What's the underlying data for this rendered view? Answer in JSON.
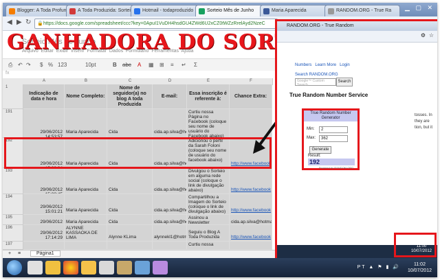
{
  "tabs": [
    {
      "label": "Blogger: A Toda Profundic",
      "color": "#f57d00"
    },
    {
      "label": "A Toda Produzida: Sortei",
      "color": "#d23a3a"
    },
    {
      "label": "Hotmail - todaproduzido",
      "color": "#2672ec"
    },
    {
      "label": "Sorteio Mês de Junho",
      "color": "#18a15f"
    },
    {
      "label": "Maria Aparecida",
      "color": "#3b5998"
    },
    {
      "label": "RANDOM.ORG - True Ra",
      "color": "#999999"
    }
  ],
  "address": "https://docs.google.com/spreadsheet/ccc?key=0ApuI1VuDH4hsdGU4ZWd6U2xCZ0tWZzRrelAyd2NzeC",
  "doc_title": "Sorteio Mês de Junho",
  "menus": [
    "Arquivo",
    "Editar",
    "Exibir",
    "Inserir",
    "Formatar",
    "Dados",
    "Formulário",
    "Ferramentas",
    "Ajuda"
  ],
  "headline": "GANHADORA DO SORTEIO",
  "toolbar": {
    "zoom": "123",
    "font_size": "10pt"
  },
  "fx": "fx",
  "columns": [
    "A",
    "B",
    "C",
    "D",
    "E",
    "F"
  ],
  "header_row": {
    "num": "1",
    "cells": [
      "Indicação de data e hora",
      "Nome Completo:",
      "Nome de seguidor(a) no blog A toda Produzida",
      "E-mail:",
      "Essa inscrição é referente à:",
      "Chance Extra:"
    ]
  },
  "rows": [
    {
      "num": "191",
      "date": "29/06/2012 14:53:57",
      "name": "Maria Aparecida",
      "nick": "Cida",
      "email": "cida.ap.silva@hotmail",
      "ref": "Curtiu nossa Página no Facebook (coloque seu nome de usuário do Facebook abaixo)",
      "extra": ""
    },
    {
      "num": "192",
      "date": "29/06/2012 15:00:04",
      "name": "Maria Aparecida",
      "nick": "Cida",
      "email": "cida.ap.silva@hotmail",
      "ref": "Adicionou o perfil da Sarah Foloni (coloque seu nome de usuário do facebook abaixo)",
      "extra": "http://www.facebook"
    },
    {
      "num": "193",
      "date": "29/06/2012 15:00:45",
      "name": "Maria Aparecida",
      "nick": "Cida",
      "email": "cida.ap.silva@hotmail",
      "ref": "Divulgou o Sorteio em alguma rede social (coloque o link de divulgação abaixo)",
      "extra": "http://www.facebook"
    },
    {
      "num": "194",
      "date": "29/06/2012 15:01:21",
      "name": "Maria Aparecida",
      "nick": "Cida",
      "email": "cida.ap.silva@hotmail",
      "ref": "Compartilhou a Imagem do Sorteio (coloque o link de divulgação abaixo)",
      "extra": "http://www.facebook"
    },
    {
      "num": "195",
      "date": "29/06/2012 15:02:06",
      "name": "Maria Aparecida",
      "nick": "Cida",
      "email": "cida.ap.silva@hotmail",
      "ref": "Assinou a Newsletter",
      "extra": "cida.ap.silva@hotmai"
    },
    {
      "num": "196",
      "date": "29/06/2012 17:14:29",
      "name": "ALYNNE KASSAOKA DE LIMA",
      "nick": "Alynne KLima",
      "email": "alynnekl1@hotmail.co",
      "ref": "Seguiu o Blog A Toda Produzida",
      "extra": "http://www.facebook"
    },
    {
      "num": "197",
      "date": "",
      "name": "",
      "nick": "",
      "email": "",
      "ref": "Curtiu nossa",
      "extra": ""
    }
  ],
  "sheet_tab": "Página1",
  "random": {
    "window_title": "RANDOM.ORG - True Random",
    "nav": [
      "Numbers",
      "Learn More",
      "Login"
    ],
    "search_label": "Search RANDOM.ORG",
    "search_placeholder": "Google™ Custom Search",
    "search_button": "Search",
    "service": "True Random Number Service",
    "generator_title": "True Random Number Generator",
    "min_label": "Min:",
    "min_value": "2",
    "max_label": "Max:",
    "max_value": "362",
    "generate": "Generate",
    "result_label": "Result:",
    "result": "192",
    "powered": "Powered by RANDOM.ORG",
    "side_text": [
      "tosses. In",
      "they are",
      "tion, but it"
    ],
    "mini_time": "11:00",
    "mini_date": "10/07/2012"
  },
  "taskbar": {
    "lang": "PT",
    "time": "11:02",
    "date": "10/07/2012"
  }
}
